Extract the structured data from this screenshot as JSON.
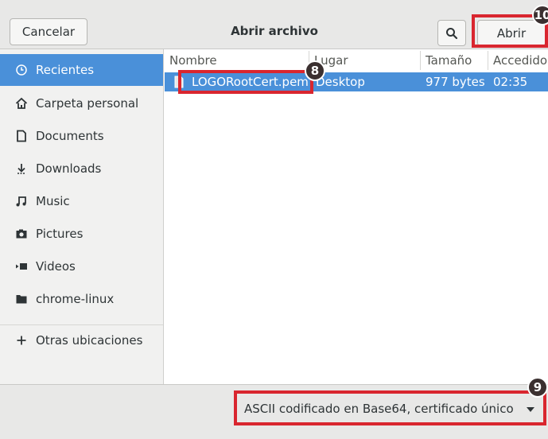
{
  "header": {
    "cancel_label": "Cancelar",
    "title": "Abrir archivo",
    "open_label": "Abrir"
  },
  "sidebar": {
    "items": [
      {
        "label": "Recientes",
        "icon": "clock-icon"
      },
      {
        "label": "Carpeta personal",
        "icon": "home-icon"
      },
      {
        "label": "Documents",
        "icon": "document-icon"
      },
      {
        "label": "Downloads",
        "icon": "download-icon"
      },
      {
        "label": "Music",
        "icon": "music-icon"
      },
      {
        "label": "Pictures",
        "icon": "camera-icon"
      },
      {
        "label": "Videos",
        "icon": "video-icon"
      },
      {
        "label": "chrome-linux",
        "icon": "folder-icon"
      },
      {
        "label": "Otras ubicaciones",
        "icon": "plus-icon"
      }
    ]
  },
  "files": {
    "columns": [
      "Nombre",
      "Lugar",
      "Tamaño",
      "Accedido"
    ],
    "rows": [
      {
        "name": "LOGORootCert.pem",
        "location": "Desktop",
        "size": "977 bytes",
        "accessed": "02:35"
      }
    ]
  },
  "footer": {
    "filter_value": "ASCII codificado en Base64, certificado único"
  },
  "markers": [
    "8",
    "9",
    "10"
  ],
  "colors": {
    "selection": "#4a90d9",
    "highlight": "#d9262f",
    "marker": "#3b3030"
  }
}
